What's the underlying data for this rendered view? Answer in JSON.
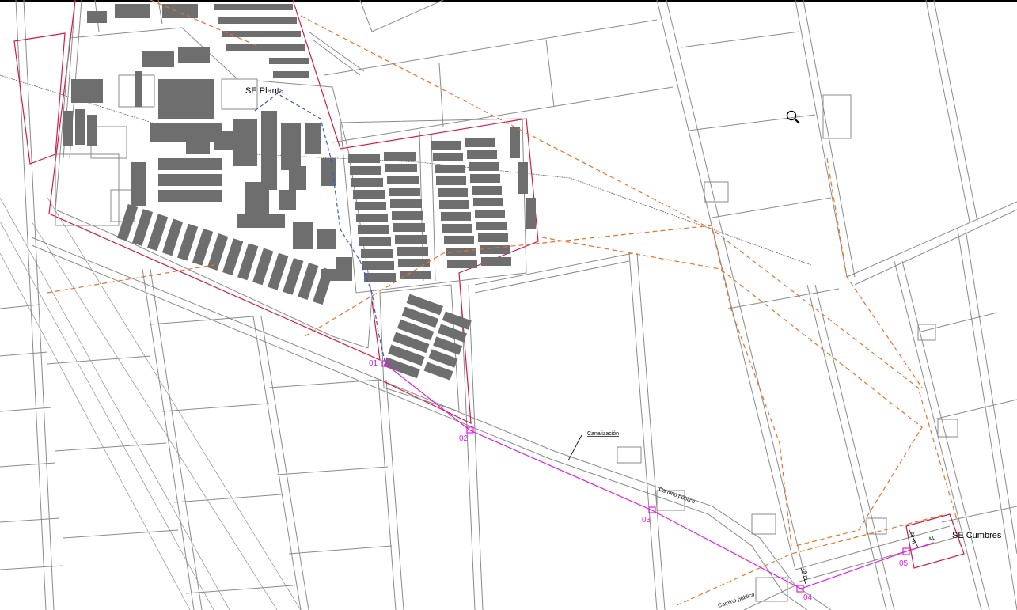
{
  "labels": {
    "se_planta": "SE Planta",
    "se_cumbres": "SE Cumbres",
    "canalizacion": "Canalización",
    "camino_publico_1": "Camino público",
    "camino_publico_2": "Camino público",
    "dim_1": "29 m",
    "dim_2": "29 m",
    "dim_3": "41"
  },
  "markers": [
    "01",
    "02",
    "03",
    "04",
    "05"
  ],
  "colors": {
    "boundary": "#d21b4a",
    "route": "#e21de2",
    "dashed_orange": "#e8722c",
    "dashed_blue": "#2f5ec8",
    "linework": "#8a8a8a",
    "panels": "#6e6e6e"
  },
  "icons": {
    "zoom": "magnifier-icon"
  }
}
